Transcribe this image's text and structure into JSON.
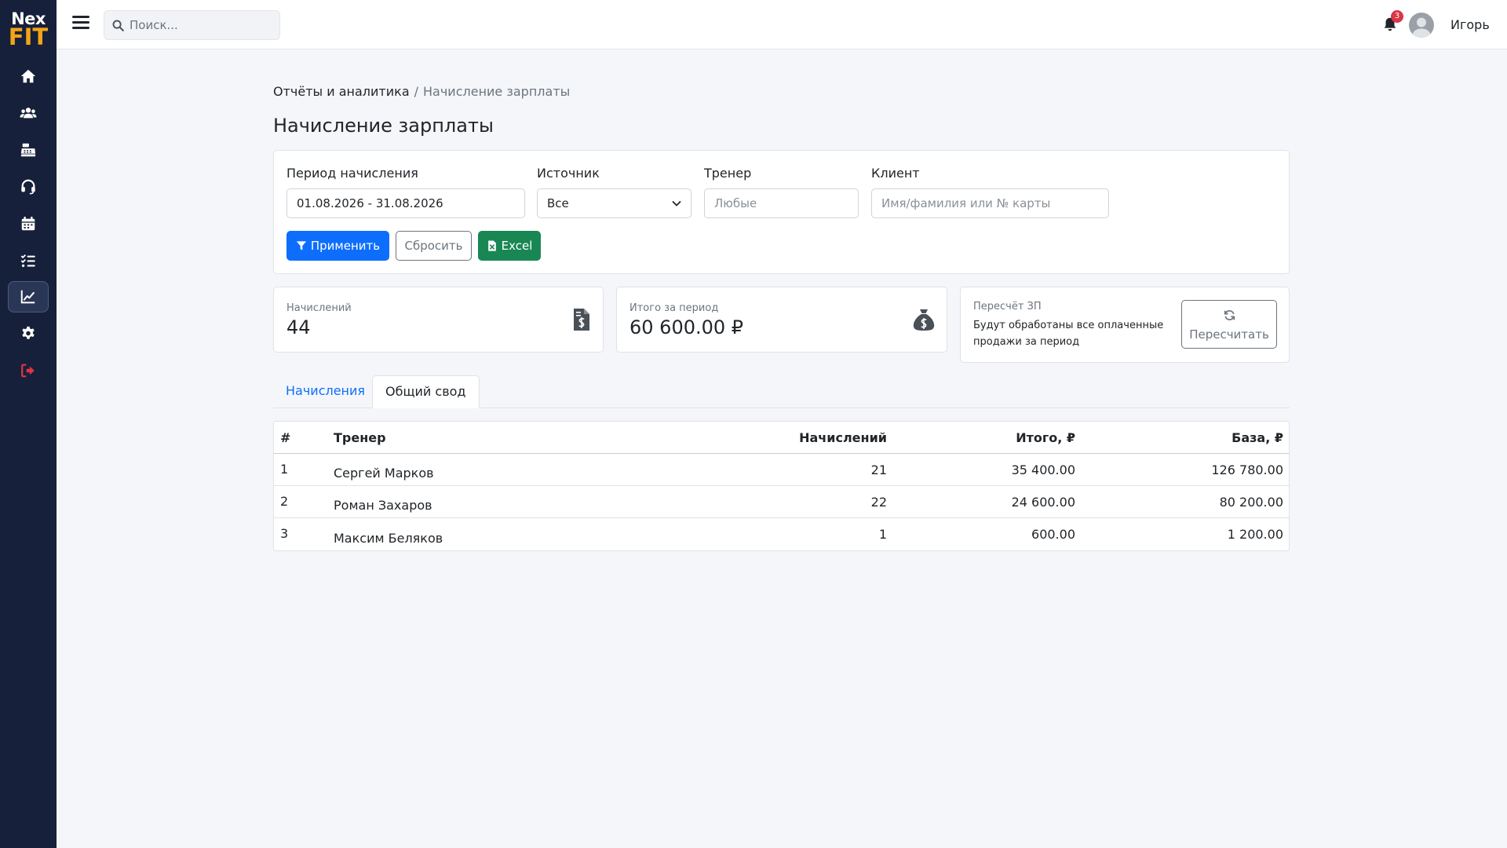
{
  "brand": {
    "line1": "Nex",
    "line2": "FIT"
  },
  "search": {
    "placeholder": "Поиск..."
  },
  "user": {
    "name": "Игорь",
    "notifications": "3"
  },
  "breadcrumb": {
    "parent": "Отчёты и аналитика",
    "separator": "/",
    "current": "Начисление зарплаты"
  },
  "page": {
    "title": "Начисление зарплаты"
  },
  "filters": {
    "period_label": "Период начисления",
    "period_value": "01.08.2026 - 31.08.2026",
    "source_label": "Источник",
    "source_value": "Все",
    "trainer_label": "Тренер",
    "trainer_placeholder": "Любые",
    "client_label": "Клиент",
    "client_placeholder": "Имя/фамилия или № карты",
    "apply_label": "Применить",
    "reset_label": "Сбросить",
    "excel_label": "Excel"
  },
  "stats": {
    "count_label": "Начислений",
    "count_value": "44",
    "total_label": "Итого за период",
    "total_value": "60 600.00 ₽",
    "recalc_title": "Пересчёт ЗП",
    "recalc_desc": "Будут обработаны все оплаченные продажи за период",
    "recalc_button": "Пересчитать"
  },
  "tabs": [
    {
      "label": "Начисления",
      "active": false
    },
    {
      "label": "Общий свод",
      "active": true
    }
  ],
  "table": {
    "headers": {
      "num": "#",
      "trainer": "Тренер",
      "count": "Начислений",
      "total": "Итого, ₽",
      "base": "База, ₽"
    },
    "rows": [
      {
        "num": "1",
        "trainer": "Сергей Марков",
        "count": "21",
        "total": "35 400.00",
        "base": "126 780.00"
      },
      {
        "num": "2",
        "trainer": "Роман Захаров",
        "count": "22",
        "total": "24 600.00",
        "base": "80 200.00"
      },
      {
        "num": "3",
        "trainer": "Максим Беляков",
        "count": "1",
        "total": "600.00",
        "base": "1 200.00"
      }
    ]
  },
  "icons": {
    "sidebar": [
      "home-icon",
      "users-icon",
      "cash-register-icon",
      "headset-icon",
      "calendar-icon",
      "tasks-icon",
      "chart-line-icon",
      "gear-icon",
      "logout-icon"
    ],
    "active_sidebar": "chart-line-icon"
  },
  "colors": {
    "sidebar": "#17203a",
    "brand_accent": "#f2a516",
    "primary": "#0d6efd",
    "success": "#198754",
    "danger": "#dc3545"
  }
}
